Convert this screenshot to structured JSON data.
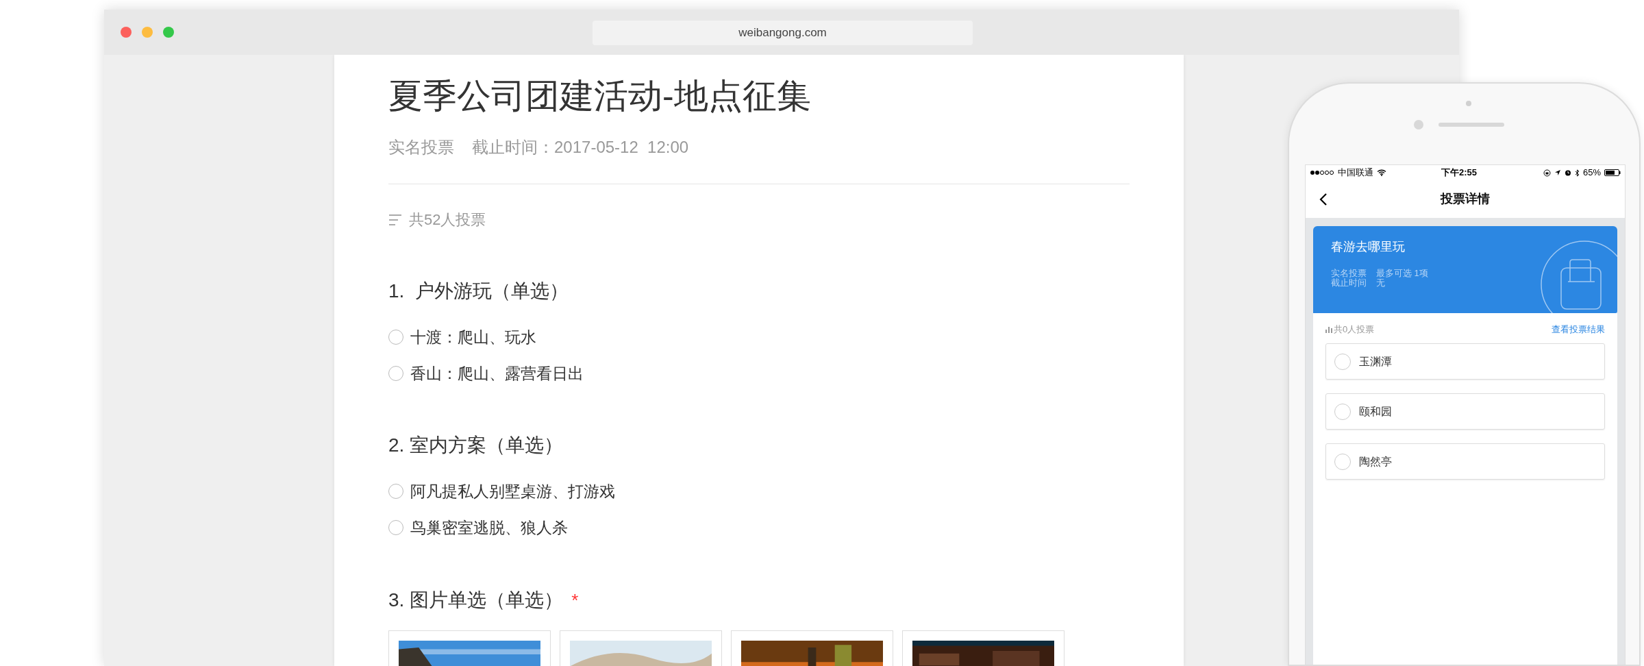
{
  "browser": {
    "url": "weibangong.com"
  },
  "form": {
    "title": "夏季公司团建活动-地点征集",
    "vote_type": "实名投票",
    "deadline": "截止时间：2017-05-12  12:00",
    "total": "共52人投票",
    "required_mark": "*",
    "questions": [
      {
        "kind": "text",
        "title": "1.  户外游玩（单选）",
        "required": false,
        "options": [
          {
            "label": "十渡：爬山、玩水",
            "selected": false
          },
          {
            "label": "香山：爬山、露营看日出",
            "selected": false
          }
        ]
      },
      {
        "kind": "text",
        "title": "2. 室内方案（单选）",
        "required": false,
        "options": [
          {
            "label": "阿凡提私人别墅桌游、打游戏",
            "selected": false
          },
          {
            "label": "鸟巢密室逃脱、狼人杀",
            "selected": false
          }
        ]
      },
      {
        "title": "3. 图片单选（单选）",
        "required": true
      }
    ]
  },
  "phone": {
    "status_bar": {
      "carrier": "中国联通",
      "time": "下午2:55",
      "battery": "65%"
    },
    "nav": {
      "title": "投票详情"
    },
    "card": {
      "title": "春游去哪里玩",
      "vote_type": "实名投票",
      "max_choice": "最多可选 1项",
      "deadline_label": "截止时间",
      "deadline": "无"
    },
    "total": "共0人投票",
    "results_link": "查看投票结果",
    "options": [
      {
        "label": "玉渊潭",
        "selected": false
      },
      {
        "label": "颐和园",
        "selected": false
      },
      {
        "label": "陶然亭",
        "selected": false
      }
    ]
  }
}
